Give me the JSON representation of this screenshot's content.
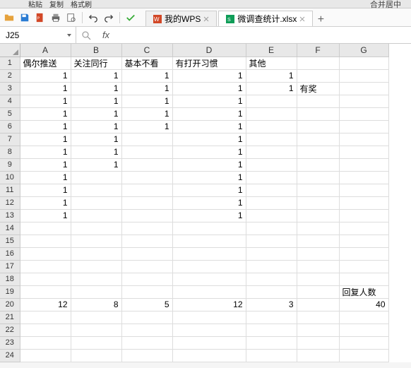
{
  "topfrag": {
    "paste": "粘贴",
    "copy": "复制",
    "format_painter": "格式刷",
    "merge": "合并居中"
  },
  "tabs": {
    "home": {
      "label": "我的WPS"
    },
    "file": {
      "label": "微调查统计.xlsx"
    }
  },
  "namebox": {
    "value": "J25"
  },
  "formula": {
    "placeholder": "fx"
  },
  "columns": [
    "A",
    "B",
    "C",
    "D",
    "E",
    "F",
    "G"
  ],
  "headers": {
    "A": "偶尔推送",
    "B": "关注同行",
    "C": "基本不看",
    "D": "有打开习惯",
    "E": "其他"
  },
  "cells": {
    "r2": {
      "A": "1",
      "B": "1",
      "C": "1",
      "D": "1",
      "E": "1"
    },
    "r3": {
      "A": "1",
      "B": "1",
      "C": "1",
      "D": "1",
      "E": "1",
      "F": "有奖"
    },
    "r4": {
      "A": "1",
      "B": "1",
      "C": "1",
      "D": "1"
    },
    "r5": {
      "A": "1",
      "B": "1",
      "C": "1",
      "D": "1"
    },
    "r6": {
      "A": "1",
      "B": "1",
      "C": "1",
      "D": "1"
    },
    "r7": {
      "A": "1",
      "B": "1",
      "D": "1"
    },
    "r8": {
      "A": "1",
      "B": "1",
      "D": "1"
    },
    "r9": {
      "A": "1",
      "B": "1",
      "D": "1"
    },
    "r10": {
      "A": "1",
      "D": "1"
    },
    "r11": {
      "A": "1",
      "D": "1"
    },
    "r12": {
      "A": "1",
      "D": "1"
    },
    "r13": {
      "A": "1",
      "D": "1"
    },
    "r19": {
      "G": "回复人数"
    },
    "r20": {
      "A": "12",
      "B": "8",
      "C": "5",
      "D": "12",
      "E": "3",
      "G": "40"
    }
  },
  "row_count": 24
}
